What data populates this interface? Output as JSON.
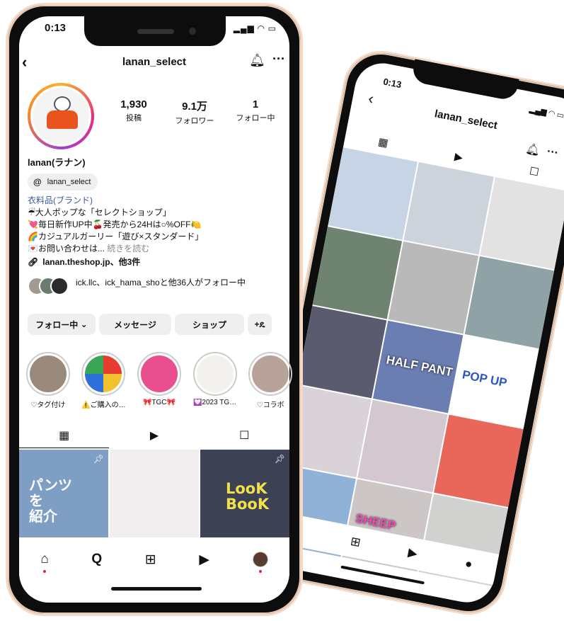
{
  "back_phone": {
    "status_time": "0:13",
    "username": "lanan_select",
    "grid_texts": [
      "HALF PANT",
      "POP UP",
      "SHEEP"
    ],
    "colors": [
      "#c7d4e6",
      "#cdd3da",
      "#e2e2e2",
      "#6f8470",
      "#b9b9b9",
      "#8fa3a7",
      "#5b5b70",
      "#6a7eb2",
      "#ffffff",
      "#d9d2d8",
      "#d3c8cf",
      "#e8665a",
      "#8fb2d6",
      "#ccc6c7",
      "#d1d1cf"
    ]
  },
  "front_phone": {
    "status_time": "0:13",
    "username": "lanan_select",
    "stats": [
      {
        "num": "1,930",
        "label": "投稿"
      },
      {
        "num": "9.1万",
        "label": "フォロワー"
      },
      {
        "num": "1",
        "label": "フォロー中"
      }
    ],
    "display_name": "lanan(ラナン)",
    "threads_handle": "lanan_select",
    "bio": {
      "category": "衣料品(ブランド)",
      "lines": [
        "☔大人ポップな「セレクトショップ」",
        "💘毎日新作UP中🍒発売から24Hは○%OFF🍋",
        "🌈カジュアルガーリー「遊び×スタンダード」",
        "💌お問い合わせは..."
      ],
      "more": "続きを読む"
    },
    "link": "lanan.theshop.jp、他3件",
    "followed_by": "ick.llc、ick_hama_shoと他36人がフォロー中",
    "buttons": {
      "follow": "フォロー中",
      "message": "メッセージ",
      "shop": "ショップ",
      "add_person": "+ዴ"
    },
    "highlights": [
      {
        "label": "♡タグ付け"
      },
      {
        "label": "⚠️ご購入の…"
      },
      {
        "label": "🎀TGC🎀"
      },
      {
        "label": "💟2023 TG…"
      },
      {
        "label": "♡コラボ"
      }
    ],
    "grid": [
      {
        "text": "パンツ\nを\n紹介",
        "color": "#7f9ec4"
      },
      {
        "text": "",
        "color": "#f1eef0"
      },
      {
        "text": "LooK\nBooK",
        "color": "#3c4254"
      },
      {
        "text": "",
        "color": "#c9b8a3"
      },
      {
        "text": "",
        "color": "#dadada"
      },
      {
        "text": "",
        "color": "#3b4657"
      }
    ]
  }
}
